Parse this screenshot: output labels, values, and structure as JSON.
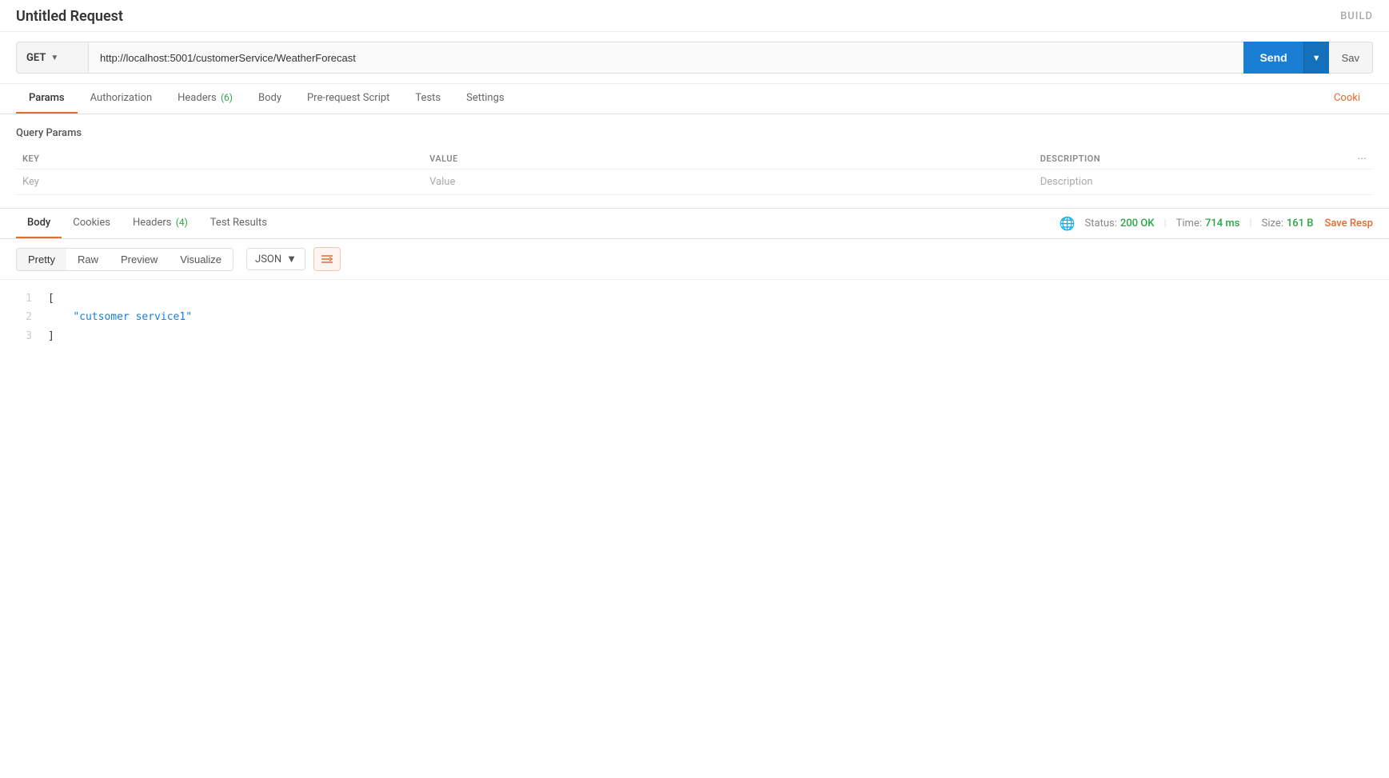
{
  "header": {
    "title": "Untitled Request",
    "build_label": "BUILD"
  },
  "url_bar": {
    "method": "GET",
    "url": "http://localhost:5001/customerService/WeatherForecast",
    "send_label": "Send",
    "save_label": "Sav"
  },
  "request_tabs": [
    {
      "id": "params",
      "label": "Params",
      "active": true,
      "badge": null
    },
    {
      "id": "authorization",
      "label": "Authorization",
      "active": false,
      "badge": null
    },
    {
      "id": "headers",
      "label": "Headers",
      "active": false,
      "badge": "(6)"
    },
    {
      "id": "body",
      "label": "Body",
      "active": false,
      "badge": null
    },
    {
      "id": "prerequest",
      "label": "Pre-request Script",
      "active": false,
      "badge": null
    },
    {
      "id": "tests",
      "label": "Tests",
      "active": false,
      "badge": null
    },
    {
      "id": "settings",
      "label": "Settings",
      "active": false,
      "badge": null
    },
    {
      "id": "cookies",
      "label": "Cooki",
      "active": false,
      "is_orange": true
    }
  ],
  "query_params": {
    "section_label": "Query Params",
    "columns": {
      "key": "KEY",
      "value": "VALUE",
      "description": "DESCRIPTION",
      "more": "···"
    },
    "placeholder_row": {
      "key": "Key",
      "value": "Value",
      "description": "Description"
    }
  },
  "response_tabs": [
    {
      "id": "body",
      "label": "Body",
      "active": true
    },
    {
      "id": "cookies",
      "label": "Cookies",
      "active": false
    },
    {
      "id": "headers",
      "label": "Headers",
      "active": false,
      "badge": "(4)"
    },
    {
      "id": "test_results",
      "label": "Test Results",
      "active": false
    }
  ],
  "response_meta": {
    "status_label": "Status:",
    "status_value": "200 OK",
    "time_label": "Time:",
    "time_value": "714 ms",
    "size_label": "Size:",
    "size_value": "161 B",
    "save_response": "Save Resp"
  },
  "response_body_toolbar": {
    "format_tabs": [
      "Pretty",
      "Raw",
      "Preview",
      "Visualize"
    ],
    "active_format": "Pretty",
    "type_label": "JSON",
    "wrap_icon": "≡→"
  },
  "code_lines": [
    {
      "num": "1",
      "content": "[",
      "type": "bracket"
    },
    {
      "num": "2",
      "content": "\"cutsomer service1\"",
      "type": "string",
      "indent": 4
    },
    {
      "num": "3",
      "content": "]",
      "type": "bracket"
    }
  ]
}
